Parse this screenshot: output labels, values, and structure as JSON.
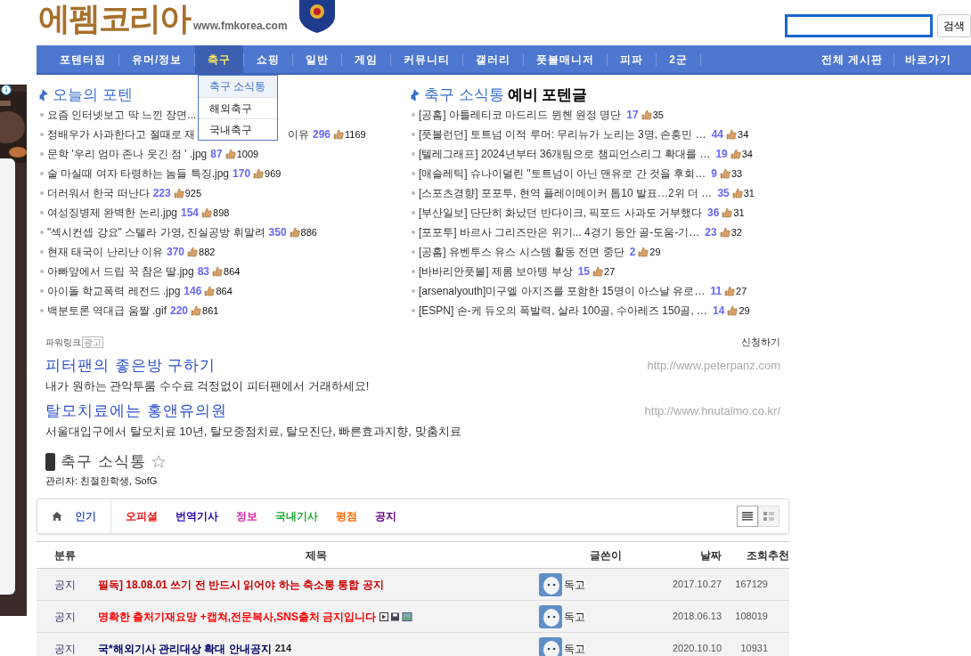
{
  "header": {
    "logo": "에펨코리아",
    "url": "www.fmkorea.com",
    "search_button": "검색"
  },
  "nav": {
    "items": [
      {
        "label": "포텐터짐",
        "selected": false
      },
      {
        "label": "유머/정보",
        "selected": false
      },
      {
        "label": "축구",
        "selected": true
      },
      {
        "label": "쇼핑",
        "selected": false
      },
      {
        "label": "일반",
        "selected": false
      },
      {
        "label": "게임",
        "selected": false
      },
      {
        "label": "커뮤니티",
        "selected": false
      },
      {
        "label": "갤러리",
        "selected": false
      },
      {
        "label": "풋볼매니저",
        "selected": false
      },
      {
        "label": "피파",
        "selected": false
      },
      {
        "label": "2군",
        "selected": false
      }
    ],
    "right_items": [
      "전체 게시판",
      "바로가기"
    ],
    "dropdown": [
      {
        "label": "축구 소식통",
        "selected": true
      },
      {
        "label": "해외축구",
        "selected": false
      },
      {
        "label": "국내축구",
        "selected": false
      }
    ]
  },
  "popular": {
    "title": "오늘의 포텐",
    "posts": [
      {
        "title": "요즘 인터넷보고 딱 느낀 장면..."
      },
      {
        "title": "정배우가 사과한다고 절때로 재",
        "hidden_tail": "이유",
        "comments": "296",
        "likes": "1169"
      },
      {
        "title": "문학 '우리 엄마 존나 웃긴 점 ' .jpg",
        "comments": "87",
        "likes": "1009"
      },
      {
        "title": "술 마실때 여자 타령하는 놈들 특징.jpg",
        "comments": "170",
        "likes": "969"
      },
      {
        "title": "더러워서 한국 떠난다",
        "comments": "223",
        "likes": "925"
      },
      {
        "title": "여성징병제 완벽한 논리.jpg",
        "comments": "154",
        "likes": "898"
      },
      {
        "title": "\"섹시컨셉 강요\" 스텔라 가영, 진실공방 휘말려",
        "comments": "350",
        "likes": "886"
      },
      {
        "title": "현재 태국이 난리난 이유",
        "comments": "370",
        "likes": "882"
      },
      {
        "title": "아빠앞에서 드립 꾹 참은 딸.jpg",
        "comments": "83",
        "likes": "864"
      },
      {
        "title": "아이돌 학교폭력 레전드 .jpg",
        "comments": "146",
        "likes": "864"
      },
      {
        "title": "백분토론 역대급 움짤 .gif",
        "comments": "220",
        "likes": "861"
      }
    ]
  },
  "news": {
    "title": "축구 소식통",
    "title_suffix": "예비 포텐글",
    "posts": [
      {
        "title": "[공홈] 아틀레티코 마드리드 뮌헨 원정 명단",
        "comments": "17",
        "likes": "35"
      },
      {
        "title": "[풋볼런던] 토트넘 이적 루머: 무리뉴가 노리는 3명, 손흥민 …",
        "comments": "44",
        "likes": "34"
      },
      {
        "title": "[텔레그래프] 2024년부터 36개팀으로 챔피언스리그 확대를 …",
        "comments": "19",
        "likes": "34"
      },
      {
        "title": "[애슬레틱] 슈나이덜린 \"토트넘이 아닌 맨유로 간 것을 후회…",
        "comments": "9",
        "likes": "33"
      },
      {
        "title": "[스포츠경향] 포포투, 현역 플레이메이커 톱10 발표…2위 더 …",
        "comments": "35",
        "likes": "31"
      },
      {
        "title": "[부산일보] 단단히 화났던 반다이크, 픽포드 사과도 거부했다",
        "comments": "36",
        "likes": "31"
      },
      {
        "title": "[포포투] 바르사 그리즈만은 위기... 4경기 동안 골-도움-기…",
        "comments": "23",
        "likes": "32"
      },
      {
        "title": "[공홈] 유벤투스 유스 시스템 활동 전면 중단",
        "comments": "2",
        "likes": "29"
      },
      {
        "title": "[바바리안풋볼] 제롬 보아텡 부상",
        "comments": "15",
        "likes": "27"
      },
      {
        "title": "[arsenalyouth]미구엘 아지즈를 포함한 15명이 아스날 유로…",
        "comments": "11",
        "likes": "27"
      },
      {
        "title": "[ESPN] 손-케 듀오의 폭발력, 살라 100골, 수아레즈 150골, …",
        "comments": "14",
        "likes": "29"
      }
    ]
  },
  "powerlink": {
    "label": "파워링크",
    "badge": "광고",
    "apply": "신청하기",
    "ads": [
      {
        "title": "피터팬의 좋은방 구하기",
        "url": "http://www.peterpanz.com",
        "description": "내가 원하는 관악투룸 수수료 걱정없이 피터팬에서 거래하세요!"
      },
      {
        "title": "탈모치료에는 홍앤유의원",
        "url": "http://www.hnutalmo.co.kr/",
        "description": "서울대입구에서 탈모치료 10년, 탈모중점치료, 탈모진단, 빠른효과지향, 맞춤치료"
      }
    ]
  },
  "board": {
    "title": "축구 소식통",
    "favorite": false,
    "admins": "관리자: 친절한학생, SofG",
    "tabs": [
      {
        "label": "인기",
        "color": "#3355cc"
      },
      {
        "label": "오피셜",
        "color": "#ee1111"
      },
      {
        "label": "번역기사",
        "color": "#2200aa"
      },
      {
        "label": "정보",
        "color": "#dd22aa"
      },
      {
        "label": "국내기사",
        "color": "#22aa33"
      },
      {
        "label": "평점",
        "color": "#ff6600"
      },
      {
        "label": "공지",
        "color": "#660088"
      }
    ],
    "view_modes": [
      {
        "kind": "list",
        "selected": true
      },
      {
        "kind": "gallery",
        "selected": false
      }
    ],
    "columns": [
      "분류",
      "제목",
      "글쓴이",
      "날짜",
      "조회",
      "추천"
    ],
    "rows": [
      {
        "category": "공지",
        "title": "필독] 18.08.01 쓰기 전 반드시 읽어야 하는 축소통 통합 공지",
        "color": "#cc0000",
        "attachments": false,
        "author": "독고",
        "date": "2017.10.27",
        "views": "167129"
      },
      {
        "category": "공지",
        "title": "명확한 출처기재요망 +캡쳐,전문복사,SNS출처 금지입니다",
        "color": "#ff0000",
        "attachments": true,
        "author": "독고",
        "date": "2018.06.13",
        "views": "108019"
      },
      {
        "category": "공지",
        "title": "국*해외기사 관리대상 확대 안내공지",
        "comments": "214",
        "color": "#000066",
        "attachments": false,
        "author": "독고",
        "date": "2020.10.10",
        "views": "10931"
      }
    ]
  }
}
